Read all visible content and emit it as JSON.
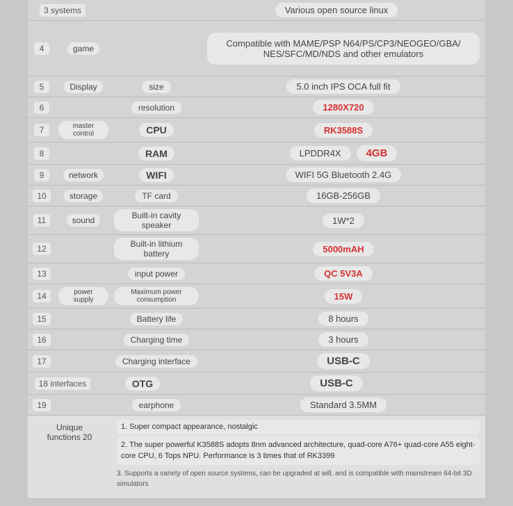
{
  "rows": [
    {
      "num": "3 systems",
      "numType": "wide",
      "cat": "",
      "sub": "",
      "val": "Various open source linux",
      "valType": "plain"
    },
    {
      "num": "4",
      "cat": "game",
      "sub": "",
      "val": "Compatible with MAME/PSP N64/PS/CP3/NEOGEO/GBA/\nNES/SFC/MD/NDS and other emulators",
      "valType": "game"
    },
    {
      "num": "5",
      "cat": "Display",
      "sub": "size",
      "val": "5.0 inch IPS OCA full fit",
      "valType": "plain"
    },
    {
      "num": "6",
      "cat": "",
      "sub": "resolution",
      "val": "1280X720",
      "valType": "red"
    },
    {
      "num": "7",
      "cat": "master control",
      "catSmall": true,
      "sub": "CPU",
      "subBold": true,
      "val": "RK3588S",
      "valType": "red"
    },
    {
      "num": "8",
      "cat": "",
      "sub": "RAM",
      "subBold": true,
      "val": "LPDDR4X",
      "sub2": "4GB",
      "valType": "split"
    },
    {
      "num": "9",
      "cat": "network",
      "sub": "WIFI",
      "subBold": true,
      "val": "WIFI 5G Bluetooth 2.4G",
      "valType": "plain"
    },
    {
      "num": "10",
      "cat": "storage",
      "sub": "TF card",
      "val": "16GB-256GB",
      "valType": "plain"
    },
    {
      "num": "11",
      "cat": "sound",
      "sub": "Built-in cavity speaker",
      "val": "1W*2",
      "valType": "plain"
    },
    {
      "num": "12",
      "cat": "",
      "sub": "Built-in lithium battery",
      "val": "5000mAH",
      "valType": "orange"
    },
    {
      "num": "13",
      "cat": "",
      "sub": "input power",
      "val": "QC 5V3A",
      "valType": "orange"
    },
    {
      "num": "14",
      "cat": "power supply",
      "catSmall": true,
      "sub": "Maximum power consumption",
      "subSmall": true,
      "val": "15W",
      "valType": "orange"
    },
    {
      "num": "15",
      "cat": "",
      "sub": "Battery life",
      "val": "8 hours",
      "valType": "plain"
    },
    {
      "num": "16",
      "cat": "",
      "sub": "Charging time",
      "val": "3 hours",
      "valType": "plain"
    },
    {
      "num": "17",
      "cat": "",
      "sub": "Charging interface",
      "val": "USB-C",
      "valType": "bold"
    },
    {
      "num": "18 interfaces",
      "numType": "wide",
      "cat": "",
      "sub": "OTG",
      "subBold": true,
      "val": "USB-C",
      "valType": "bold"
    },
    {
      "num": "19",
      "cat": "",
      "sub": "earphone",
      "val": "Standard 3.5MM",
      "valType": "plain"
    }
  ],
  "unique": {
    "label": "Unique\nfunctions 20",
    "points": [
      "1. Super compact appearance, nostalgic",
      "2. The super powerful K3588S adopts 8nm advanced architecture, quad-core A76+ quad-core A55 eight-core CPU, 6 Tops NPU. Performance is 3 times that of RK3399",
      "3. Supports a variety of open source systems, can be upgraded at will, and is compatible with mainstream 64-bit 3D simulators"
    ]
  }
}
